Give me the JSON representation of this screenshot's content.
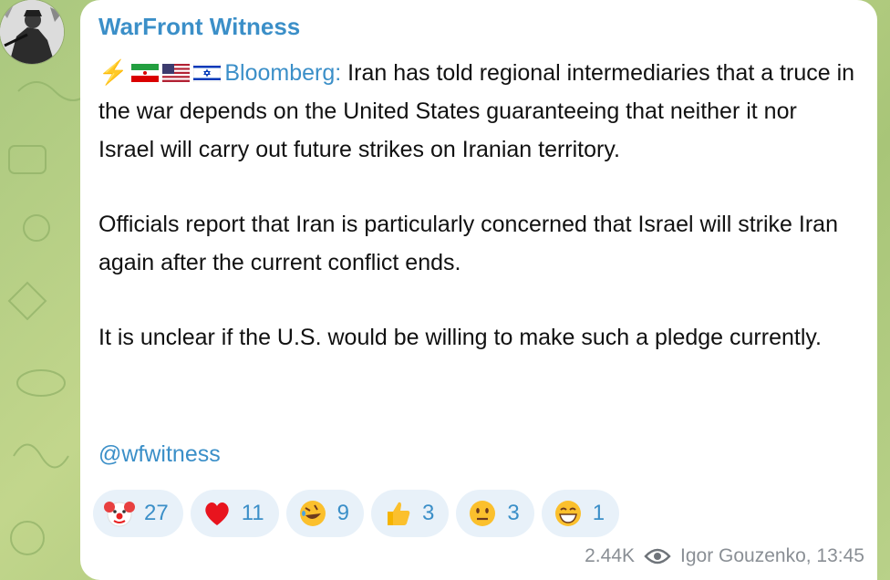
{
  "post": {
    "channel_name": "WarFront Witness",
    "source_label": "Bloomberg:",
    "paragraph1_text": " Iran has told regional intermediaries that a truce in the war depends on the United States guaranteeing that neither it nor Israel will carry out future strikes on Iranian territory.",
    "paragraph2": "Officials report that Iran is particularly concerned that Israel will strike Iran again after the current conflict ends.",
    "paragraph3": "It is unclear if the U.S. would be willing to make such a pledge currently.",
    "handle": "@wfwitness",
    "lead_icons": [
      "lightning-icon",
      "iran-flag-icon",
      "us-flag-icon",
      "israel-flag-icon"
    ]
  },
  "reactions": [
    {
      "emoji": "clown-face",
      "count": "27"
    },
    {
      "emoji": "red-heart",
      "count": "11"
    },
    {
      "emoji": "rolling-laughing-face",
      "count": "9"
    },
    {
      "emoji": "thumbs-up",
      "count": "3"
    },
    {
      "emoji": "neutral-face",
      "count": "3"
    },
    {
      "emoji": "grinning-face",
      "count": "1"
    }
  ],
  "footer": {
    "views": "2.44K",
    "views_icon": "eye-icon",
    "author_time": "Igor Gouzenko, 13:45"
  },
  "colors": {
    "accent": "#3b8fc8",
    "reaction_bg": "#e8f1f9",
    "meta_gray": "#8a8f95",
    "wallpaper": "#b3cc82"
  }
}
